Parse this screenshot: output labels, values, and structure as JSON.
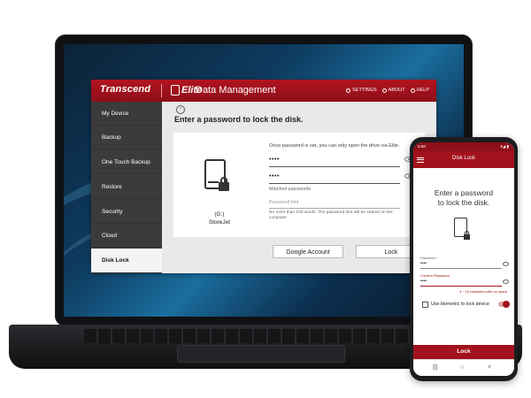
{
  "app": {
    "brand": "Transcend",
    "product": "Elite",
    "title": "Data Management",
    "header_links": [
      "SETTINGS",
      "ABOUT",
      "HELP"
    ]
  },
  "sidebar": {
    "items": [
      {
        "label": "My Device"
      },
      {
        "label": "Backup"
      },
      {
        "label": "One Touch Backup"
      },
      {
        "label": "Restore"
      },
      {
        "label": "Security"
      },
      {
        "label": "Cloud"
      },
      {
        "label": "Disk Lock",
        "active": true
      }
    ]
  },
  "main": {
    "title": "Enter a password to lock the disk.",
    "drive_letter": "(G:)",
    "drive_name": "StoreJet",
    "info": "Once password is set, you can only open the drive via Elite.",
    "password_value": "••••",
    "confirm_value": "••••",
    "matched_text": "Matched passwords",
    "hint_placeholder": "Password hint",
    "hint_note": "No more than 100 words. The password hint will be shared on the computer",
    "google_button": "Google Account",
    "lock_button": "Lock"
  },
  "phone": {
    "status_time": "5:58",
    "status_right": "▾◢ ▮",
    "title": "Disk Lock",
    "heading_line1": "Enter a password",
    "heading_line2": "to lock the disk.",
    "password_label": "Password",
    "password_value": "••••",
    "confirm_label": "Confirm Password",
    "confirm_value": "••••",
    "helper": "4 ~ 16 characters with no space",
    "biometric_label": "Use biometric to lock device",
    "lock_button": "Lock",
    "nav": [
      "|||",
      "○",
      "<"
    ]
  },
  "colors": {
    "brand_red": "#a3121c",
    "sidebar_dark": "#3b3b3b"
  }
}
